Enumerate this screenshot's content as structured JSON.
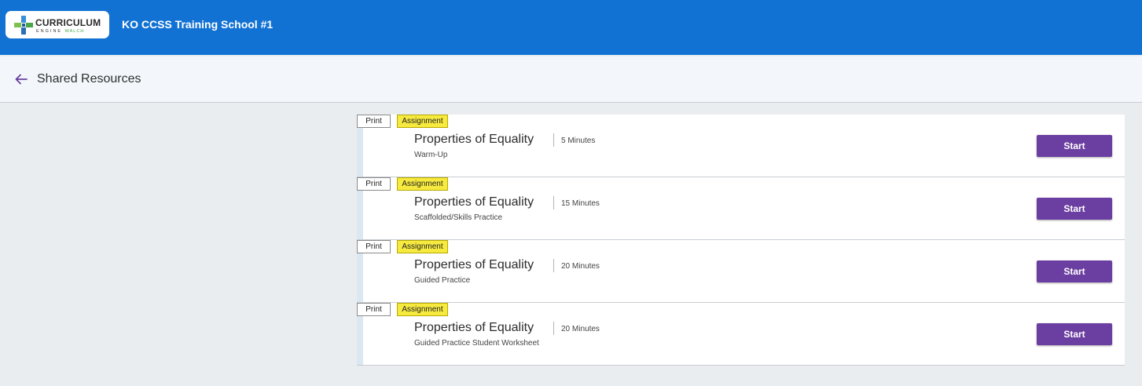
{
  "header": {
    "logo_line1": "CURRICULUM",
    "logo_line2": "ENGINE",
    "logo_line2_brand": "WALCH",
    "school_name": "KO CCSS Training School #1",
    "bar_color": "#1272d4"
  },
  "nav": {
    "back_icon": "arrow-left-icon",
    "page_title": "Shared Resources"
  },
  "resources": [
    {
      "print_label": "Print",
      "tag_label": "Assignment",
      "title": "Properties of Equality",
      "duration": "5 Minutes",
      "subtitle": "Warm-Up",
      "action_label": "Start"
    },
    {
      "print_label": "Print",
      "tag_label": "Assignment",
      "title": "Properties of Equality",
      "duration": "15 Minutes",
      "subtitle": "Scaffolded/Skills Practice",
      "action_label": "Start"
    },
    {
      "print_label": "Print",
      "tag_label": "Assignment",
      "title": "Properties of Equality",
      "duration": "20 Minutes",
      "subtitle": "Guided Practice",
      "action_label": "Start"
    },
    {
      "print_label": "Print",
      "tag_label": "Assignment",
      "title": "Properties of Equality",
      "duration": "20 Minutes",
      "subtitle": "Guided Practice Student Worksheet",
      "action_label": "Start"
    }
  ],
  "colors": {
    "accent_button": "#6b3ea1",
    "assignment_tag": "#f7ea3f",
    "back_arrow": "#6b3ea1"
  }
}
